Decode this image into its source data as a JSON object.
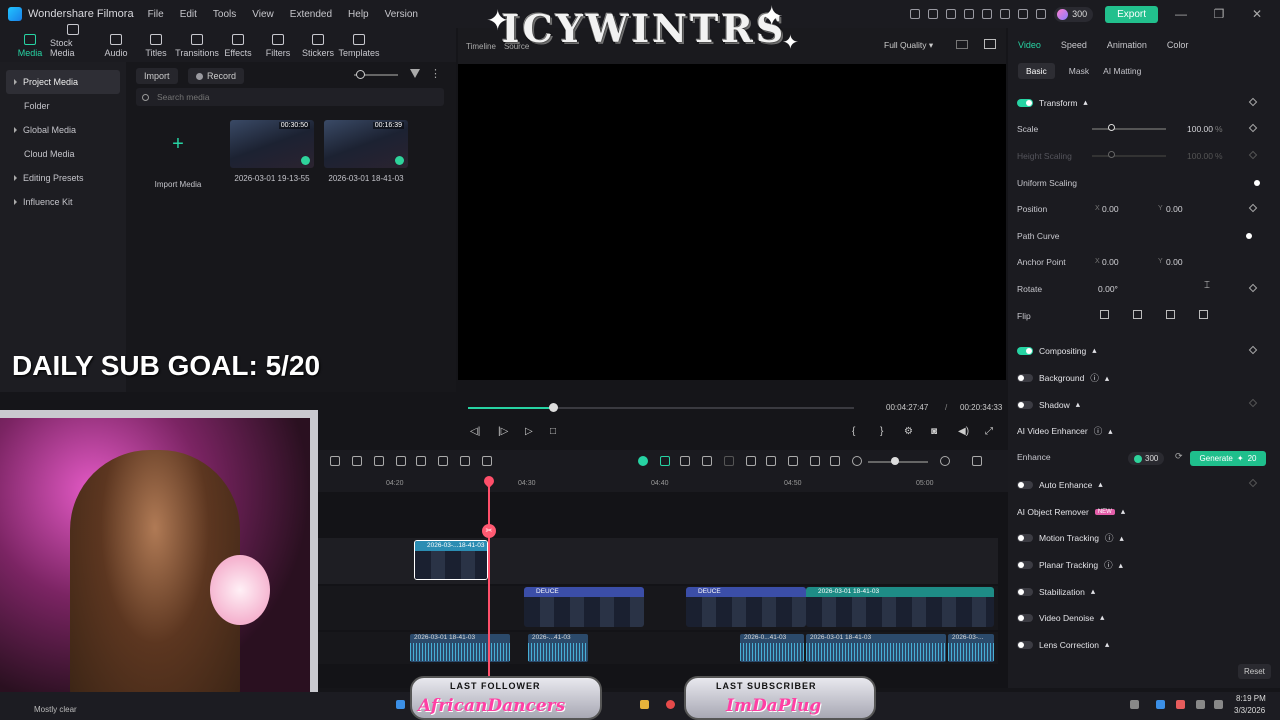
{
  "app": {
    "name": "Wondershare Filmora",
    "menu": [
      "File",
      "Edit",
      "Tools",
      "View",
      "Extended",
      "Help",
      "Version"
    ],
    "credits": "300",
    "export_label": "Export"
  },
  "media_toolbar": [
    "Media",
    "Stock Media",
    "Audio",
    "Titles",
    "Transitions",
    "Effects",
    "Filters",
    "Stickers",
    "Templates"
  ],
  "left_nav": {
    "items": [
      "Project Media",
      "Folder",
      "Global Media",
      "Cloud Media",
      "Editing Presets",
      "Influence Kit"
    ]
  },
  "media_panel": {
    "import_label": "Import",
    "record_label": "Record",
    "search_placeholder": "Search media",
    "import_tile_label": "Import Media",
    "tiles": [
      {
        "label": "2026-03-01 19-13-55",
        "duration": "00:30:50"
      },
      {
        "label": "2026-03-01 18-41-03",
        "duration": "00:16:39"
      }
    ]
  },
  "player": {
    "tabs": [
      "Timeline",
      "Source"
    ],
    "quality": "Full Quality",
    "time_current": "00:04:27:47",
    "time_sep": "/",
    "time_total": "00:20:34:33",
    "progress": 0.22,
    "overlay_logo": "ICYWINTRS"
  },
  "properties": {
    "tabs": [
      "Video",
      "Speed",
      "Animation",
      "Color"
    ],
    "subtabs": [
      "Basic",
      "Mask",
      "AI Matting"
    ],
    "transform": "Transform",
    "scale_label": "Scale",
    "scale_value": "100.00",
    "scale_unit": "%",
    "height_scaling_label": "Height Scaling",
    "height_scaling_value": "100.00",
    "uniform_scaling_label": "Uniform Scaling",
    "position_label": "Position",
    "position_x": "0.00",
    "position_y": "0.00",
    "axis_x": "X",
    "axis_y": "Y",
    "path_curve_label": "Path Curve",
    "anchor_label": "Anchor Point",
    "anchor_x": "0.00",
    "anchor_y": "0.00",
    "rotate_label": "Rotate",
    "rotate_value": "0.00°",
    "flip_label": "Flip",
    "compositing": "Compositing",
    "background": "Background",
    "shadow": "Shadow",
    "ai_video_enhancer": "AI Video Enhancer",
    "enhance_label": "Enhance",
    "enhance_credits": "300",
    "generate_label": "Generate",
    "generate_cost": "20",
    "auto_enhance": "Auto Enhance",
    "ai_object_remover": "AI Object Remover",
    "new_badge": "NEW",
    "motion_tracking": "Motion Tracking",
    "planar_tracking": "Planar Tracking",
    "stabilization": "Stabilization",
    "video_denoise": "Video Denoise",
    "lens_correction": "Lens Correction",
    "reset_label": "Reset"
  },
  "timeline": {
    "ticks": [
      "04:20",
      "04:30",
      "04:40",
      "04:50",
      "05:00"
    ],
    "selected_clip": "2026-03-...18-41-03",
    "video_clips": [
      "DEUCE",
      "DEUCE",
      "2026-03-01 18-41-03"
    ],
    "audio_clips": [
      "2026-03-01 18-41-03",
      "2026-...41-03",
      "2026-0...41-03",
      "2026-03-01 18-41-03",
      "2026-03-..."
    ]
  },
  "overlay": {
    "sub_goal": "DAILY SUB GOAL: 5/20",
    "last_follower_title": "LAST FOLLOWER",
    "last_follower_name": "AfricanDancers",
    "last_subscriber_title": "LAST SUBSCRIBER",
    "last_subscriber_name": "ImDaPlug"
  },
  "taskbar": {
    "weather": "Mostly clear",
    "time": "8:19 PM",
    "date": "3/3/2026"
  }
}
